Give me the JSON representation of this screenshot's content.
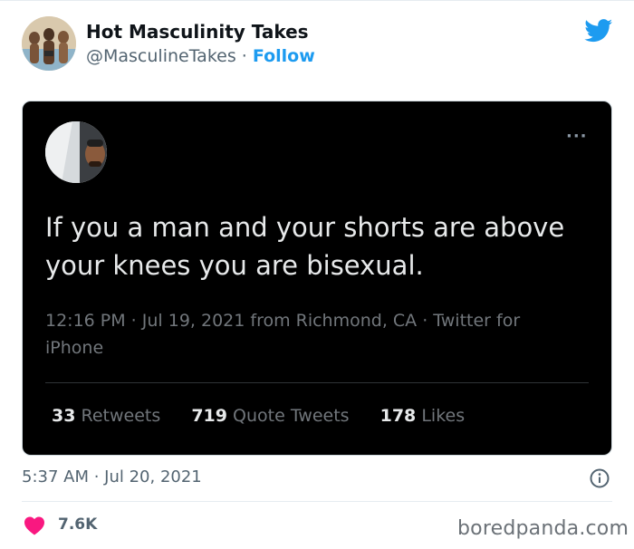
{
  "author": {
    "name": "Hot Masculinity Takes",
    "handle": "@MasculineTakes",
    "separator": "·",
    "follow_label": "Follow"
  },
  "embedded_tweet": {
    "text": "If you a man and your shorts are above your knees you are bisexual.",
    "meta": "12:16 PM · Jul 19, 2021 from Richmond, CA · Twitter for iPhone",
    "stats": {
      "retweets_count": "33",
      "retweets_label": "Retweets",
      "quote_count": "719",
      "quote_label": "Quote Tweets",
      "likes_count": "178",
      "likes_label": "Likes"
    },
    "more_label": "···"
  },
  "footer": {
    "timestamp": "5:37 AM · Jul 20, 2021",
    "likes": "7.6K"
  },
  "watermark": "boredpanda.com",
  "icons": {
    "brand": "twitter-bird-icon",
    "info": "info-icon",
    "like": "heart-icon"
  },
  "colors": {
    "twitter_blue": "#1d9bf0",
    "heart_red": "#f91880",
    "dark_bg": "#000000"
  }
}
